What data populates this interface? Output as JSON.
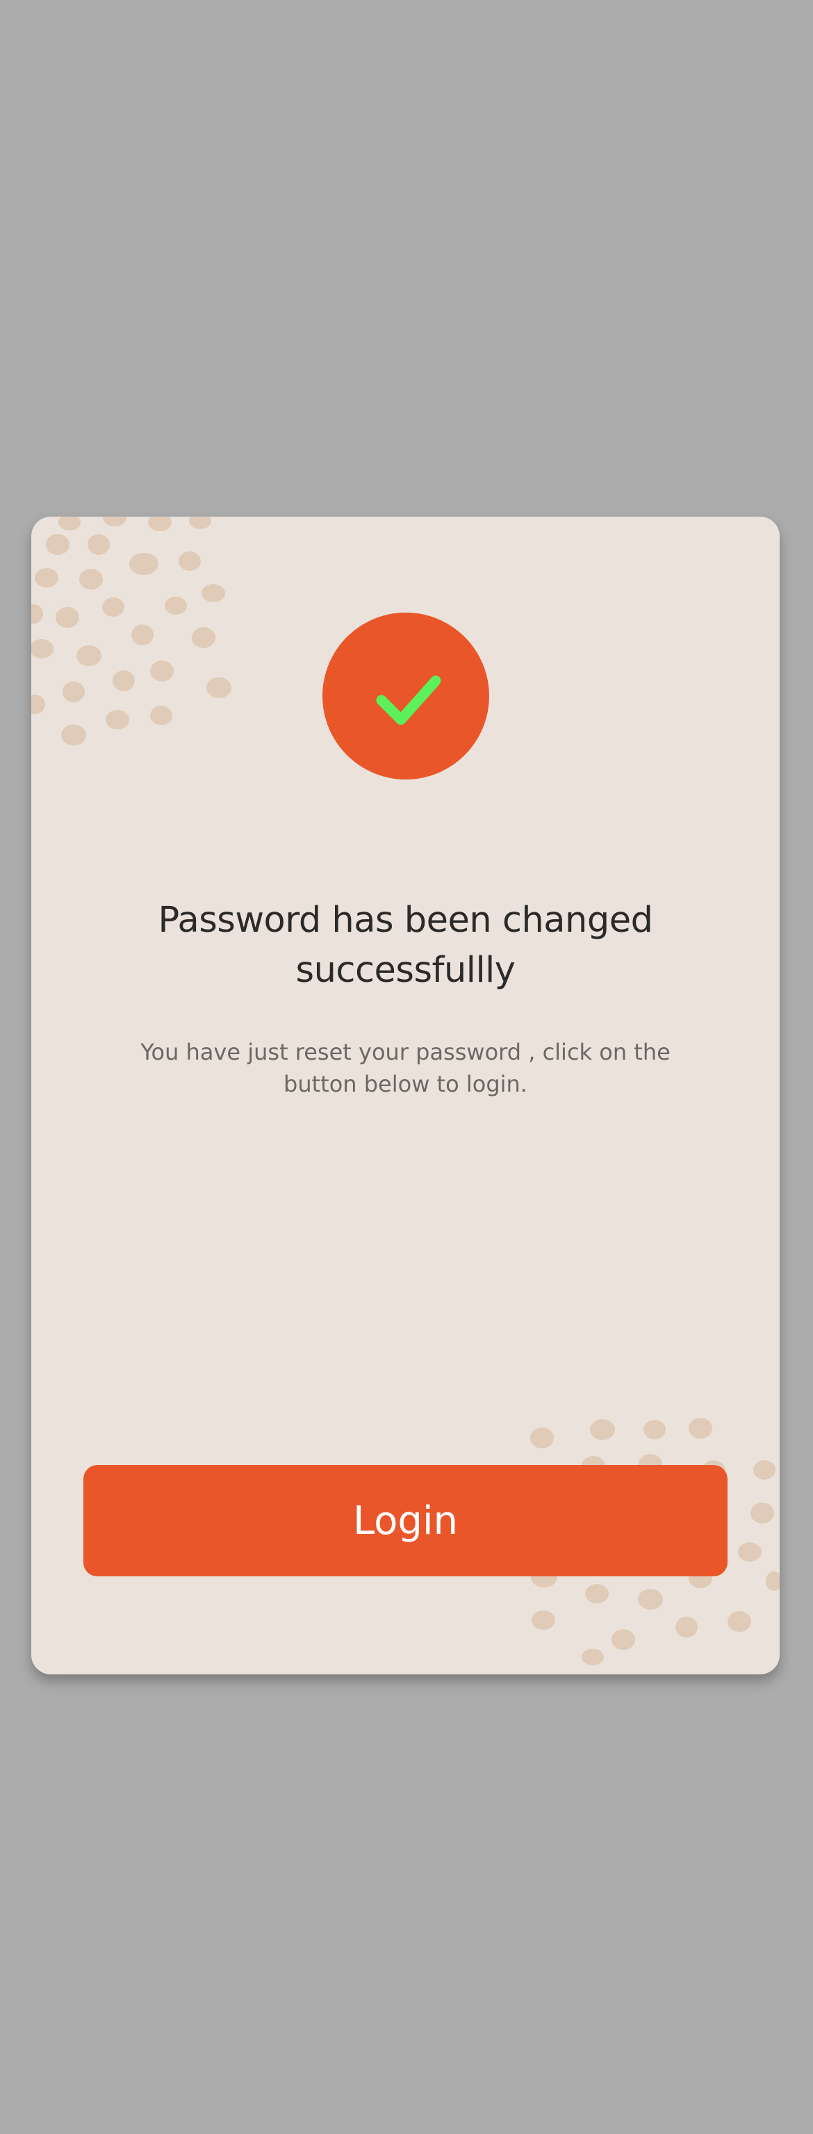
{
  "dialog": {
    "icon": "check-icon",
    "title": "Password has been changed successfullly",
    "message": "You have just reset your password , click on the button below to login.",
    "login_label": "Login"
  },
  "colors": {
    "background": "#acacac",
    "card": "#ebe3db",
    "accent": "#e8562a",
    "check": "#5cf05a",
    "dots": "#dfcbb8",
    "title_text": "#2b2a28",
    "body_text": "#6b6864"
  }
}
